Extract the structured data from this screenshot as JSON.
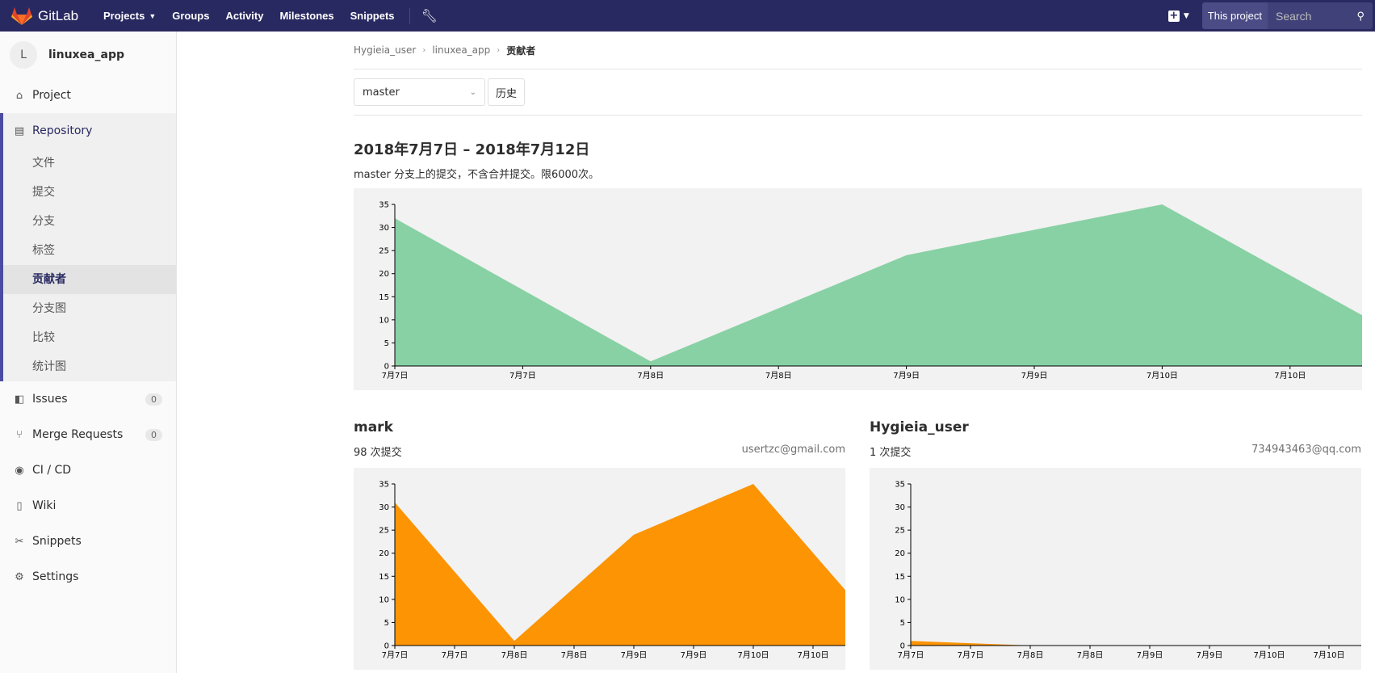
{
  "navbar": {
    "brand": "GitLab",
    "links": [
      "Projects",
      "Groups",
      "Activity",
      "Milestones",
      "Snippets"
    ],
    "scope_label": "This project",
    "search_placeholder": "Search",
    "brand_color": "#292961"
  },
  "sidebar": {
    "project_initial": "L",
    "project_name": "linuxea_app",
    "project": "Project",
    "repository": "Repository",
    "repo_items": [
      "文件",
      "提交",
      "分支",
      "标签",
      "贡献者",
      "分支图",
      "比较",
      "统计图"
    ],
    "repo_active": "贡献者",
    "issues": {
      "label": "Issues",
      "count": "0"
    },
    "merge_requests": {
      "label": "Merge Requests",
      "count": "0"
    },
    "cicd": "CI / CD",
    "wiki": "Wiki",
    "snippets": "Snippets",
    "settings": "Settings"
  },
  "breadcrumb": {
    "items": [
      "Hygieia_user",
      "linuxea_app"
    ],
    "current": "贡献者"
  },
  "toolbar": {
    "branch": "master",
    "history_label": "历史"
  },
  "range_title": "2018年7月7日 – 2018年7月12日",
  "range_subtitle": "master 分支上的提交，不含合并提交。限6000次。",
  "contributors": [
    {
      "name": "mark",
      "commits": "98 次提交",
      "email": "usertzc@gmail.com"
    },
    {
      "name": "Hygieia_user",
      "commits": "1 次提交",
      "email": "734943463@qq.com"
    }
  ],
  "chart_data": [
    {
      "type": "area",
      "title": "",
      "color": "#88d1a4",
      "x_tick_labels": [
        "7月7日",
        "7月7日",
        "7月8日",
        "7月8日",
        "7月9日",
        "7月9日",
        "7月10日",
        "7月10日"
      ],
      "y_ticks": [
        0,
        5,
        10,
        15,
        20,
        25,
        30,
        35
      ],
      "ylim": [
        0,
        35
      ],
      "x": [
        0,
        1,
        2,
        3,
        4,
        4.15
      ],
      "values": [
        32,
        1,
        24,
        35,
        11,
        10
      ],
      "x_domain": [
        0,
        4.15
      ]
    },
    {
      "type": "area",
      "title": "",
      "color": "#fc9403",
      "x_tick_labels": [
        "7月7日",
        "7月7日",
        "7月8日",
        "7月8日",
        "7月9日",
        "7月9日",
        "7月10日",
        "7月10日"
      ],
      "y_ticks": [
        0,
        5,
        10,
        15,
        20,
        25,
        30,
        35
      ],
      "ylim": [
        0,
        35
      ],
      "x": [
        0,
        1,
        2,
        3,
        4,
        4.15
      ],
      "values": [
        31,
        1,
        24,
        35,
        12,
        11
      ],
      "x_domain": [
        0,
        4.15
      ]
    },
    {
      "type": "area",
      "title": "",
      "color": "#fc9403",
      "x_tick_labels": [
        "7月7日",
        "7月7日",
        "7月8日",
        "7月8日",
        "7月9日",
        "7月9日",
        "7月10日",
        "7月10日"
      ],
      "y_ticks": [
        0,
        5,
        10,
        15,
        20,
        25,
        30,
        35
      ],
      "ylim": [
        0,
        35
      ],
      "x": [
        0,
        1,
        2,
        3,
        4,
        4.15
      ],
      "values": [
        1,
        0,
        0,
        0,
        0,
        0
      ],
      "x_domain": [
        0,
        4.15
      ]
    }
  ]
}
